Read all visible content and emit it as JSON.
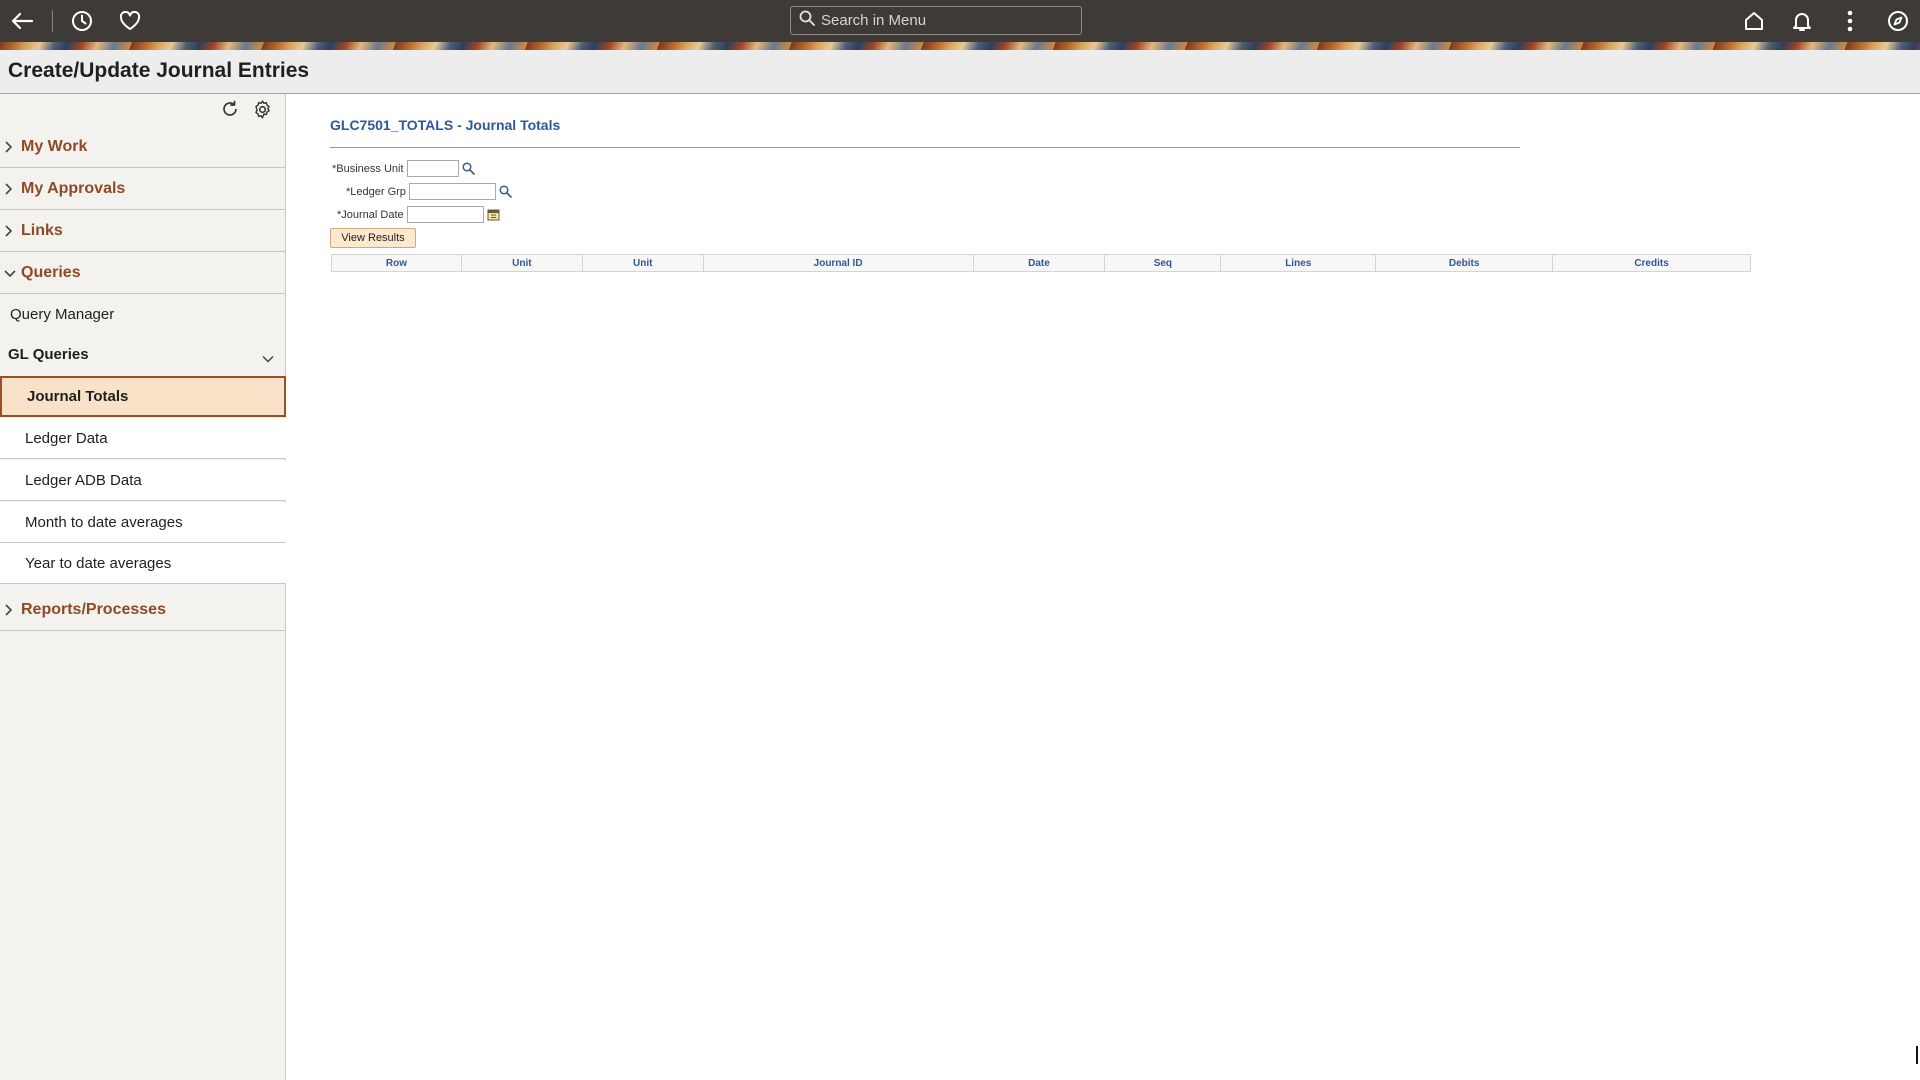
{
  "topbar": {
    "icons": [
      "back-arrow-icon",
      "history-icon",
      "favorites-heart-icon",
      "home-icon",
      "bell-icon",
      "more-vertical-icon",
      "navigator-compass-icon"
    ],
    "search_placeholder": "Search in Menu"
  },
  "page": {
    "title": "Create/Update Journal Entries"
  },
  "sidebar": {
    "tools": [
      "refresh-icon",
      "settings-gear-icon"
    ],
    "sections": {
      "my_work": "My Work",
      "my_approvals": "My Approvals",
      "links": "Links",
      "queries": "Queries",
      "reports": "Reports/Processes"
    },
    "query_manager": "Query Manager",
    "gl_queries": {
      "label": "GL Queries",
      "items": [
        {
          "label": "Journal Totals",
          "active": true
        },
        {
          "label": "Ledger Data",
          "active": false
        },
        {
          "label": "Ledger ADB Data",
          "active": false
        },
        {
          "label": "Month to date averages",
          "active": false
        },
        {
          "label": "Year to date averages",
          "active": false
        }
      ]
    },
    "accent_color": "#8d4a25"
  },
  "main": {
    "heading": "GLC7501_TOTALS - Journal Totals",
    "fields": {
      "business_unit": {
        "label": "*Business Unit",
        "value": ""
      },
      "ledger_grp": {
        "label": "*Ledger Grp",
        "value": ""
      },
      "journal_date": {
        "label": "*Journal Date",
        "value": ""
      }
    },
    "view_results_label": "View Results",
    "grid": {
      "columns": [
        "Row",
        "Unit",
        "Unit",
        "Journal ID",
        "Date",
        "Seq",
        "Lines",
        "Debits",
        "Credits"
      ],
      "rows": []
    },
    "heading_color": "#30569a"
  }
}
